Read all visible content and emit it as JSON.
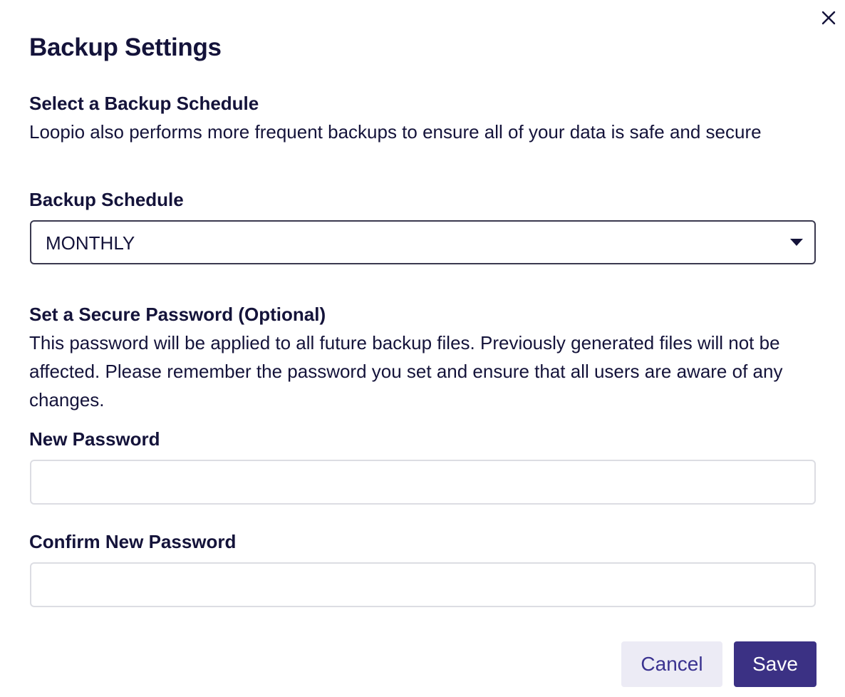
{
  "dialog": {
    "title": "Backup Settings",
    "close_icon": "close-icon"
  },
  "schedule_section": {
    "heading": "Select a Backup Schedule",
    "description": "Loopio also performs more frequent backups to ensure all of your data is safe and secure",
    "field_label": "Backup Schedule",
    "selected_value": "MONTHLY",
    "caret_icon": "caret-down-icon"
  },
  "password_section": {
    "heading": "Set a Secure Password (Optional)",
    "description": "This password will be applied to all future backup files. Previously generated files will not be affected. Please remember the password you set and ensure that all users are aware of any changes.",
    "new_password_label": "New Password",
    "new_password_value": "",
    "confirm_password_label": "Confirm New Password",
    "confirm_password_value": ""
  },
  "actions": {
    "cancel_label": "Cancel",
    "save_label": "Save"
  },
  "colors": {
    "text": "#14133a",
    "primary": "#3b3184",
    "secondary_bg": "#ecebf5",
    "secondary_text": "#3a3290",
    "input_border": "#dcdde3",
    "select_border": "#3a394f"
  }
}
